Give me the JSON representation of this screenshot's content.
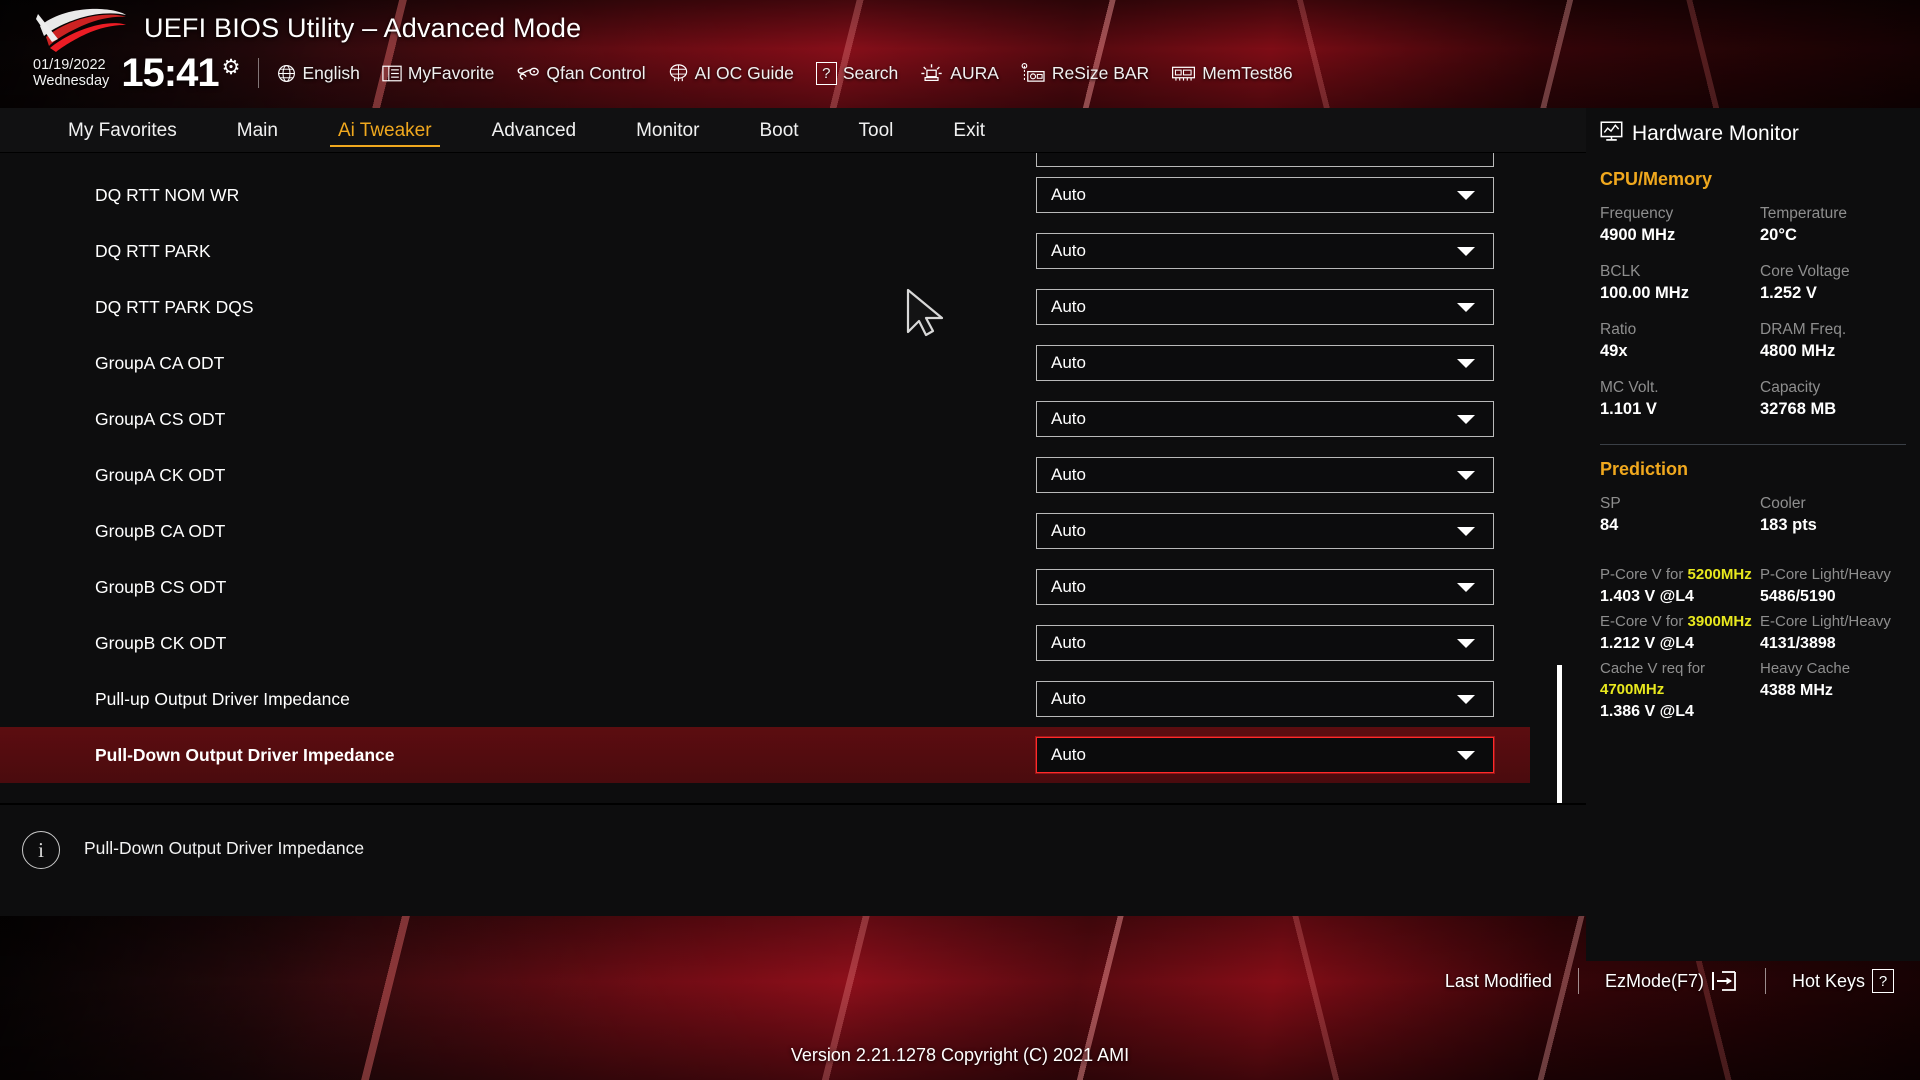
{
  "header": {
    "title": "UEFI BIOS Utility – Advanced Mode",
    "date": "01/19/2022",
    "weekday": "Wednesday",
    "time": "15:41",
    "gear_icon": "gear-icon",
    "toolbar": [
      {
        "icon": "globe-icon",
        "label": "English"
      },
      {
        "icon": "list-icon",
        "label": "MyFavorite"
      },
      {
        "icon": "fan-icon",
        "label": "Qfan Control"
      },
      {
        "icon": "brain-icon",
        "label": "AI OC Guide"
      },
      {
        "icon": "question-icon",
        "label": "Search"
      },
      {
        "icon": "aura-icon",
        "label": "AURA"
      },
      {
        "icon": "gpu-icon",
        "label": "ReSize BAR"
      },
      {
        "icon": "memory-icon",
        "label": "MemTest86"
      }
    ]
  },
  "nav": {
    "tabs": [
      {
        "label": "My Favorites",
        "active": false
      },
      {
        "label": "Main",
        "active": false
      },
      {
        "label": "Ai Tweaker",
        "active": true
      },
      {
        "label": "Advanced",
        "active": false
      },
      {
        "label": "Monitor",
        "active": false
      },
      {
        "label": "Boot",
        "active": false
      },
      {
        "label": "Tool",
        "active": false
      },
      {
        "label": "Exit",
        "active": false
      }
    ]
  },
  "settings": {
    "rows": [
      {
        "label": "DQ RTT NOM WR",
        "value": "Auto",
        "selected": false
      },
      {
        "label": "DQ RTT PARK",
        "value": "Auto",
        "selected": false
      },
      {
        "label": "DQ RTT PARK DQS",
        "value": "Auto",
        "selected": false
      },
      {
        "label": "GroupA CA ODT",
        "value": "Auto",
        "selected": false
      },
      {
        "label": "GroupA CS ODT",
        "value": "Auto",
        "selected": false
      },
      {
        "label": "GroupA CK ODT",
        "value": "Auto",
        "selected": false
      },
      {
        "label": "GroupB CA ODT",
        "value": "Auto",
        "selected": false
      },
      {
        "label": "GroupB CS ODT",
        "value": "Auto",
        "selected": false
      },
      {
        "label": "GroupB CK ODT",
        "value": "Auto",
        "selected": false
      },
      {
        "label": "Pull-up Output Driver Impedance",
        "value": "Auto",
        "selected": false
      },
      {
        "label": "Pull-Down Output Driver Impedance",
        "value": "Auto",
        "selected": true
      }
    ]
  },
  "infobar": {
    "icon": "info-icon",
    "text": "Pull-Down Output Driver Impedance"
  },
  "hardware_monitor": {
    "title": "Hardware Monitor",
    "title_icon": "monitor-chart-icon",
    "cpu_memory": {
      "heading": "CPU/Memory",
      "items": [
        {
          "key": "Frequency",
          "value": "4900 MHz"
        },
        {
          "key": "Temperature",
          "value": "20°C"
        },
        {
          "key": "BCLK",
          "value": "100.00 MHz"
        },
        {
          "key": "Core Voltage",
          "value": "1.252 V"
        },
        {
          "key": "Ratio",
          "value": "49x"
        },
        {
          "key": "DRAM Freq.",
          "value": "4800 MHz"
        },
        {
          "key": "MC Volt.",
          "value": "1.101 V"
        },
        {
          "key": "Capacity",
          "value": "32768 MB"
        }
      ]
    },
    "prediction": {
      "heading": "Prediction",
      "items": [
        {
          "key": "SP",
          "value": "84"
        },
        {
          "key": "Cooler",
          "value": "183 pts"
        }
      ],
      "details": [
        {
          "key_pre": "P-Core V for ",
          "key_hz": "5200MHz",
          "key_post": "",
          "value": "1.403 V @L4"
        },
        {
          "key_pre": "P-Core",
          "key_hz": "",
          "key_post": " Light/Heavy",
          "value": "5486/5190"
        },
        {
          "key_pre": "E-Core V for ",
          "key_hz": "3900MHz",
          "key_post": "",
          "value": "1.212 V @L4"
        },
        {
          "key_pre": "E-Core",
          "key_hz": "",
          "key_post": " Light/Heavy",
          "value": "4131/3898"
        },
        {
          "key_pre": "Cache V req for ",
          "key_hz": "4700MHz",
          "key_post": "",
          "value": "1.386 V @L4"
        },
        {
          "key_pre": "Heavy Cache",
          "key_hz": "",
          "key_post": "",
          "value": "4388 MHz"
        }
      ]
    }
  },
  "bottombar": {
    "last_modified": "Last Modified",
    "ez_mode": "EzMode(F7)",
    "ez_mode_icon": "enter-arrow-icon",
    "hot_keys": "Hot Keys",
    "hot_keys_key": "?",
    "version": "Version 2.21.1278 Copyright (C) 2021 AMI"
  },
  "colors": {
    "accent_gold": "#f0a81e",
    "accent_yellow": "#e8e81e",
    "selected_row": "#5c0d10",
    "selected_border": "#ff2a2a",
    "panel_bg": "#0d0d0e"
  }
}
